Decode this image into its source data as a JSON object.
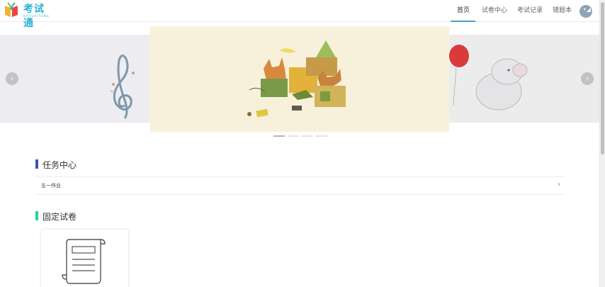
{
  "header": {
    "logo": {
      "title": "考试通",
      "subtitle": "KAOSHITONG"
    },
    "nav": [
      {
        "label": "首页",
        "active": true
      },
      {
        "label": "试卷中心",
        "active": false
      },
      {
        "label": "考试记录",
        "active": false
      },
      {
        "label": "错题本",
        "active": false
      }
    ],
    "avatar_icon": "user-avatar-icon"
  },
  "carousel": {
    "slide_count": 4,
    "active_index": 0,
    "prev_icon": "chevron-left-icon",
    "next_icon": "chevron-right-icon",
    "prev_glyph": "‹",
    "next_glyph": "›",
    "slides": [
      "treble-clef-illustration",
      "foxes-illustration",
      "elephant-balloon-illustration"
    ]
  },
  "sections": {
    "tasks": {
      "title": "任务中心",
      "accent": "#3f51b5",
      "items": [
        {
          "label": "五一作业",
          "chevron": "›"
        }
      ]
    },
    "papers": {
      "title": "固定试卷",
      "accent": "#2ecf9a",
      "cards": [
        {
          "icon": "scroll-document-icon"
        }
      ]
    }
  },
  "colors": {
    "brand": "#2bb3d3",
    "nav_underline": "#46a1c8"
  }
}
